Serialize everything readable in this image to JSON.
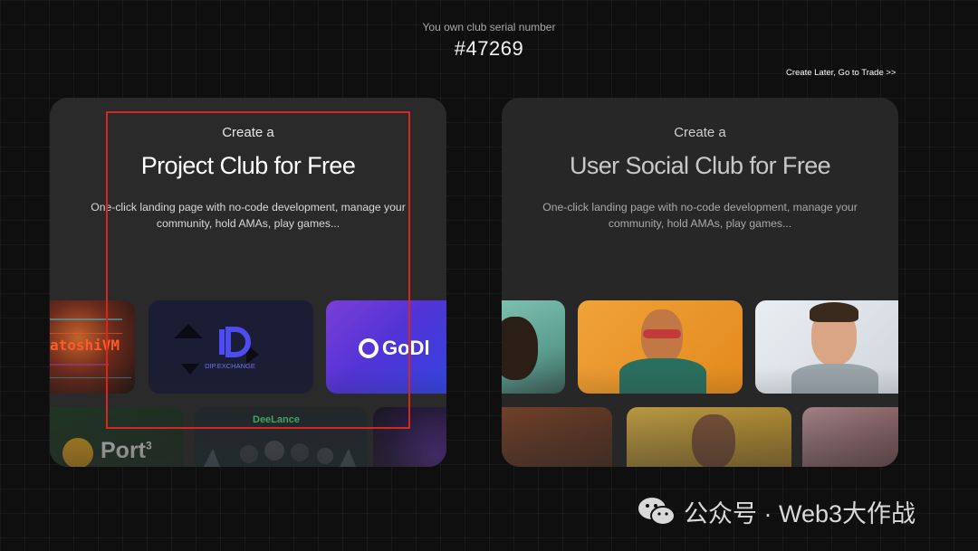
{
  "header": {
    "serial_label": "You own club serial number",
    "serial_number": "#47269",
    "create_later_link": "Create Later, Go to Trade >>"
  },
  "project_card": {
    "eyebrow": "Create a",
    "title": "Project Club for Free",
    "description": "One-click landing page with no-code development, manage your community, hold AMAs, play games...",
    "tiles": {
      "satoshivm": "atoshiVM",
      "dip_exchange": "DIP.EXCHANGE",
      "godl": "GoDl",
      "port3": "Port",
      "port3_sup": "3",
      "deelance": "DeeLance"
    }
  },
  "social_card": {
    "eyebrow": "Create a",
    "title": "User Social Club for Free",
    "description": "One-click landing page with no-code development, manage your community, hold AMAs, play games..."
  },
  "watermark": {
    "text": "公众号 · Web3大作战",
    "icon": "wechat-icon"
  },
  "colors": {
    "background": "#0f0f10",
    "card": "#2a2a2b",
    "highlight": "#d7261e"
  }
}
